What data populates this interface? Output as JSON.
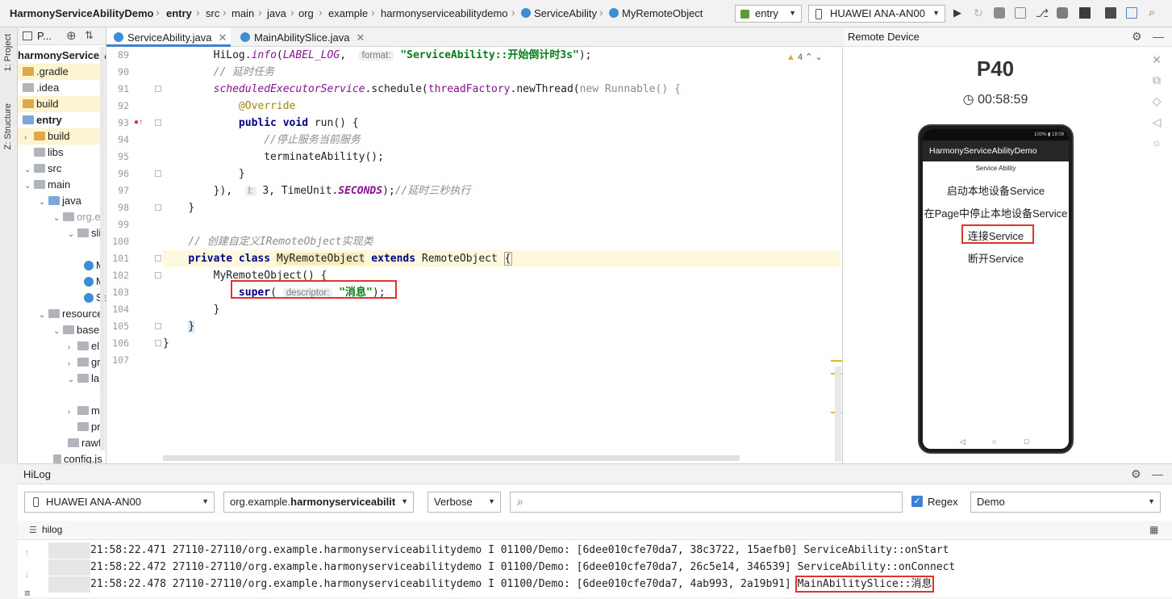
{
  "navbar": {
    "breadcrumbs": [
      "HarmonyServiceAbilityDemo",
      "entry",
      "src",
      "main",
      "java",
      "org",
      "example",
      "harmonyserviceabilitydemo",
      "ServiceAbility",
      "MyRemoteObject"
    ],
    "run_config": "entry",
    "device": "HUAWEI ANA-AN00"
  },
  "left_strip": {
    "project_tab": "1: Project",
    "structure_tab": "Z: Structure"
  },
  "project": {
    "header": "P...",
    "items": [
      {
        "label": "harmonyServiceAbi",
        "bold": true
      },
      {
        "label": ".gradle"
      },
      {
        "label": ".idea"
      },
      {
        "label": "build"
      },
      {
        "label": "entry",
        "bold": true
      },
      {
        "label": "build"
      },
      {
        "label": "libs"
      },
      {
        "label": "src"
      },
      {
        "label": "main"
      },
      {
        "label": "java"
      },
      {
        "label": "org.e"
      },
      {
        "label": "sli"
      },
      {
        "label": "M"
      },
      {
        "label": "M"
      },
      {
        "label": "Se"
      },
      {
        "label": "resource"
      },
      {
        "label": "base"
      },
      {
        "label": "el"
      },
      {
        "label": "gr"
      },
      {
        "label": "la"
      },
      {
        "label": "m"
      },
      {
        "label": "pr"
      },
      {
        "label": "rawfi"
      },
      {
        "label": "config.js"
      }
    ]
  },
  "editor": {
    "tabs": [
      {
        "label": "ServiceAbility.java",
        "active": true
      },
      {
        "label": "MainAbilitySlice.java",
        "active": false
      }
    ],
    "warning_count": "4",
    "line_numbers": [
      "89",
      "90",
      "91",
      "92",
      "93",
      "94",
      "95",
      "96",
      "97",
      "98",
      "99",
      "100",
      "101",
      "102",
      "103",
      "104",
      "105",
      "106",
      "107"
    ],
    "code": {
      "l89_a": "HiLog.",
      "l89_b": "info",
      "l89_c": "(",
      "l89_d": "LABEL_LOG",
      "l89_e": ",  ",
      "l89_hint": "format:",
      "l89_str": "\"ServiceAbility::开始倒计时3s\"",
      "l89_end": ");",
      "l90": "// 延时任务",
      "l91_a": "scheduledExecutorService",
      "l91_b": ".schedule(",
      "l91_c": "threadFactory",
      "l91_d": ".newThread(",
      "l91_e": "new",
      "l91_f": " Runnable() {",
      "l92": "@Override",
      "l93_kw": "public void",
      "l93_rest": " run() {",
      "l94": "//停止服务当前服务",
      "l95": "terminateAbility();",
      "l96": "}",
      "l97_a": "}),  ",
      "l97_hint": "l:",
      "l97_b": " 3, TimeUnit.",
      "l97_c": "SECONDS",
      "l97_d": ");",
      "l97_e": "//延时三秒执行",
      "l98": "}",
      "l100": "// 创建自定义IRemoteObject实现类",
      "l101_kw": "private class",
      "l101_name": "MyRemoteObject",
      "l101_kw2": "extends",
      "l101_rest": " RemoteObject ",
      "l101_brace": "{",
      "l102": "MyRemoteObject() {",
      "l103_kw": "super",
      "l103_a": "( ",
      "l103_hint": "descriptor:",
      "l103_str": "\"消息\"",
      "l103_end": ");",
      "l104": "}",
      "l105": "}",
      "l106": "}"
    }
  },
  "remote": {
    "title": "Remote Device",
    "device_name": "P40",
    "timer": "00:58:59",
    "status_right": "100% ▮ 19:09",
    "app_title": "HarmonyServiceAbilityDemo",
    "page_subtitle": "Service Ability",
    "buttons": [
      "启动本地设备Service",
      "在Page中停止本地设备Service",
      "连接Service",
      "断开Service"
    ]
  },
  "hilog": {
    "title": "HiLog",
    "device": "HUAWEI ANA-AN00",
    "package_prefix": "org.example.",
    "package_bold": "harmonyserviceabilit",
    "level": "Verbose",
    "search_placeholder": "",
    "regex_label": "Regex",
    "regex_checked": true,
    "filter": "Demo",
    "sub_label": "hilog",
    "lines": [
      {
        "prefix": "21:58:22.471 27110-27110/org.example.harmonyserviceabilitydemo I 01100/Demo: [6dee010cfe70da7, 38c3722, 15aefb0] ",
        "msg": "ServiceAbility::onStart"
      },
      {
        "prefix": "21:58:22.472 27110-27110/org.example.harmonyserviceabilitydemo I 01100/Demo: [6dee010cfe70da7, 26c5e14, 346539] ",
        "msg": "ServiceAbility::onConnect"
      },
      {
        "prefix": "21:58:22.478 27110-27110/org.example.harmonyserviceabilitydemo I 01100/Demo: [6dee010cfe70da7, 4ab993, 2a19b91] ",
        "msg": "MainAbilitySlice::消息"
      }
    ]
  }
}
